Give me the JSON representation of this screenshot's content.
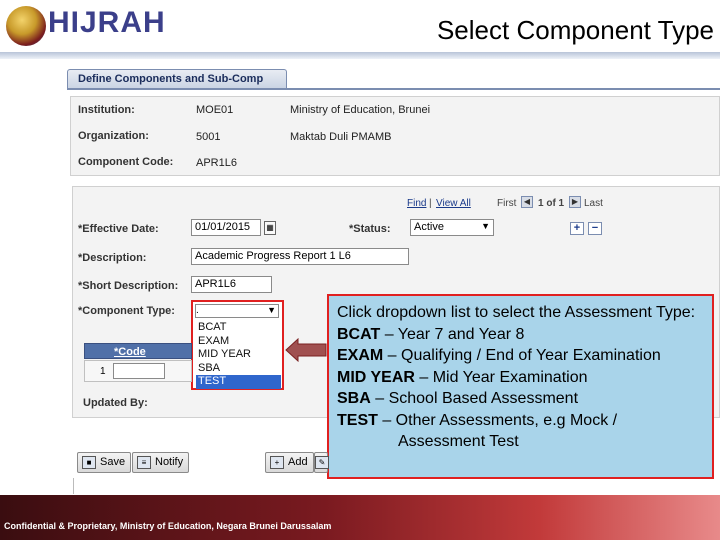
{
  "header": {
    "logo_text": "HIJRAH",
    "slide_title": "Select Component Type"
  },
  "page": {
    "tab_label": "Define Components and Sub-Comp"
  },
  "info": {
    "institution_label": "Institution:",
    "institution_code": "MOE01",
    "institution_name": "Ministry of Education, Brunei",
    "organization_label": "Organization:",
    "organization_code": "5001",
    "organization_name": "Maktab Duli PMAMB",
    "component_code_label": "Component Code:",
    "component_code": "APR1L6"
  },
  "nav": {
    "find": "Find",
    "view_all": "View All",
    "first": "First",
    "range": "1 of 1",
    "last": "Last"
  },
  "form": {
    "effective_date_label": "*Effective Date:",
    "effective_date": "01/01/2015",
    "status_label": "*Status:",
    "status_value": "Active",
    "description_label": "*Description:",
    "description": "Academic Progress Report 1 L6",
    "short_description_label": "*Short Description:",
    "short_description": "APR1L6",
    "component_type_label": "*Component Type:",
    "component_type_value": ".",
    "component_type_options": [
      "BCAT",
      "EXAM",
      "MID YEAR",
      "SBA",
      "TEST"
    ],
    "updated_by_label": "Updated By:"
  },
  "grid": {
    "code_header": "*Code",
    "col2_header": "*C",
    "row_number": "1"
  },
  "callout": {
    "intro": "Click dropdown list to select the Assessment Type:",
    "items": [
      {
        "term": "BCAT",
        "desc": " – Year 7 and Year 8"
      },
      {
        "term": "EXAM",
        "desc": " – Qualifying / End of Year Examination"
      },
      {
        "term": "MID YEAR",
        "desc": " – Mid Year Examination"
      },
      {
        "term": "SBA",
        "desc": " – School Based Assessment"
      },
      {
        "term": "TEST",
        "desc": " – Other Assessments, e.g Mock /"
      }
    ],
    "continuation": "Assessment Test"
  },
  "buttons": {
    "save": "Save",
    "notify": "Notify",
    "add": "Add"
  },
  "footer": {
    "text": "Confidential & Proprietary, Ministry of Education, Negara Brunei Darussalam"
  },
  "colors": {
    "highlight_border": "#e02020",
    "callout_bg": "#a9d4ea",
    "selected_option": "#2f66cc"
  }
}
